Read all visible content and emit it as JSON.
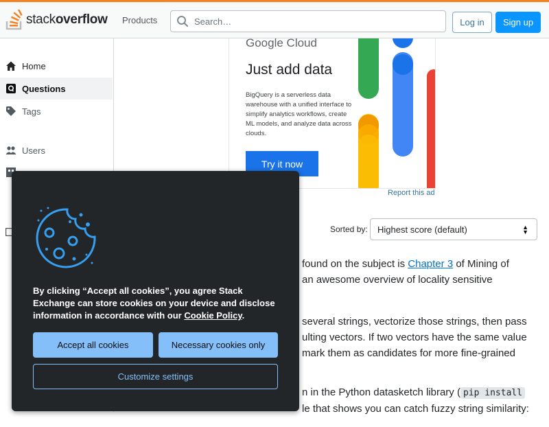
{
  "header": {
    "logo_light": "stack",
    "logo_bold": "overflow",
    "products": "Products",
    "search_placeholder": "Search…",
    "login": "Log in",
    "signup": "Sign up",
    "accent": "#f48225"
  },
  "sidebar": {
    "items": [
      {
        "label": "Home",
        "icon": "home-icon"
      },
      {
        "label": "Questions",
        "icon": "questions-icon",
        "active": true
      },
      {
        "label": "Tags",
        "icon": "tag-icon"
      },
      {
        "label": "Users",
        "icon": "users-icon"
      }
    ]
  },
  "ad": {
    "brand": "Google Cloud",
    "title": "Just add data",
    "body": "BigQuery is a serverless data warehouse with a unified interface to simplify analytics workflows, create ML models, and analyze data across clouds.",
    "cta": "Try it now",
    "report": "Report this ad"
  },
  "sort": {
    "label": "Sorted by:",
    "selected": "Highest score (default)"
  },
  "answer": {
    "p1_pre": "ve found on the subject is ",
    "p1_link": "Chapter 3",
    "p1_post": " of Mining of",
    "p1_line2": "an awesome overview of locality sensitive",
    "p2_line1": "several strings, vectorize those strings, then pass",
    "p2_line2": "ulting vectors. If two vectors have the same value",
    "p2_line3": "mark them as candidates for more fine-grained",
    "p3_pre": "n in the Python datasketch library (",
    "p3_code": "pip install",
    "p3_line2": "le that shows you can catch fuzzy string similarity:"
  },
  "cookie": {
    "text_pre": "By clicking “Accept all cookies”, you agree Stack Exchange can store cookies on your device and disclose information in accordance with our ",
    "policy_link": "Cookie Policy",
    "text_post": ".",
    "accept": "Accept all cookies",
    "necessary": "Necessary cookies only",
    "customize": "Customize settings",
    "accent": "#85bff9"
  }
}
